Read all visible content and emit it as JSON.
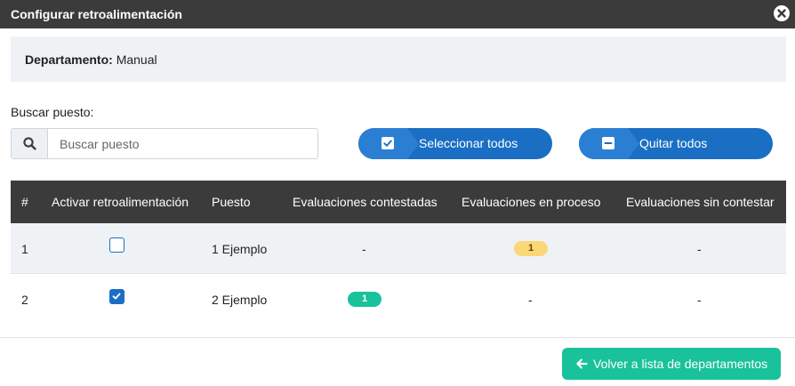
{
  "modal": {
    "title": "Configurar retroalimentación"
  },
  "department": {
    "label": "Departamento:",
    "value": "Manual"
  },
  "search": {
    "label": "Buscar puesto:",
    "placeholder": "Buscar puesto"
  },
  "actions": {
    "select_all": "Seleccionar todos",
    "remove_all": "Quitar todos"
  },
  "table": {
    "headers": [
      "#",
      "Activar retroalimentación",
      "Puesto",
      "Evaluaciones contestadas",
      "Evaluaciones en proceso",
      "Evaluaciones sin contestar"
    ],
    "rows": [
      {
        "num": "1",
        "active": false,
        "puesto": "1 Ejemplo",
        "contestadas": "-",
        "en_proceso": "1",
        "sin_contestar": "-"
      },
      {
        "num": "2",
        "active": true,
        "puesto": "2 Ejemplo",
        "contestadas": "1",
        "en_proceso": "-",
        "sin_contestar": "-"
      }
    ]
  },
  "footer": {
    "back_label": "Volver a lista de departamentos"
  },
  "colors": {
    "header": "#3b3b3b",
    "primary": "#1a6fc4",
    "success": "#19c29a",
    "warning": "#fcd776",
    "panel": "#eef2f5"
  },
  "icons": {
    "close": "close-icon",
    "search": "search-icon",
    "select_all": "checkbox-checked-icon",
    "remove_all": "checkbox-minus-icon",
    "back": "arrow-left-icon"
  }
}
